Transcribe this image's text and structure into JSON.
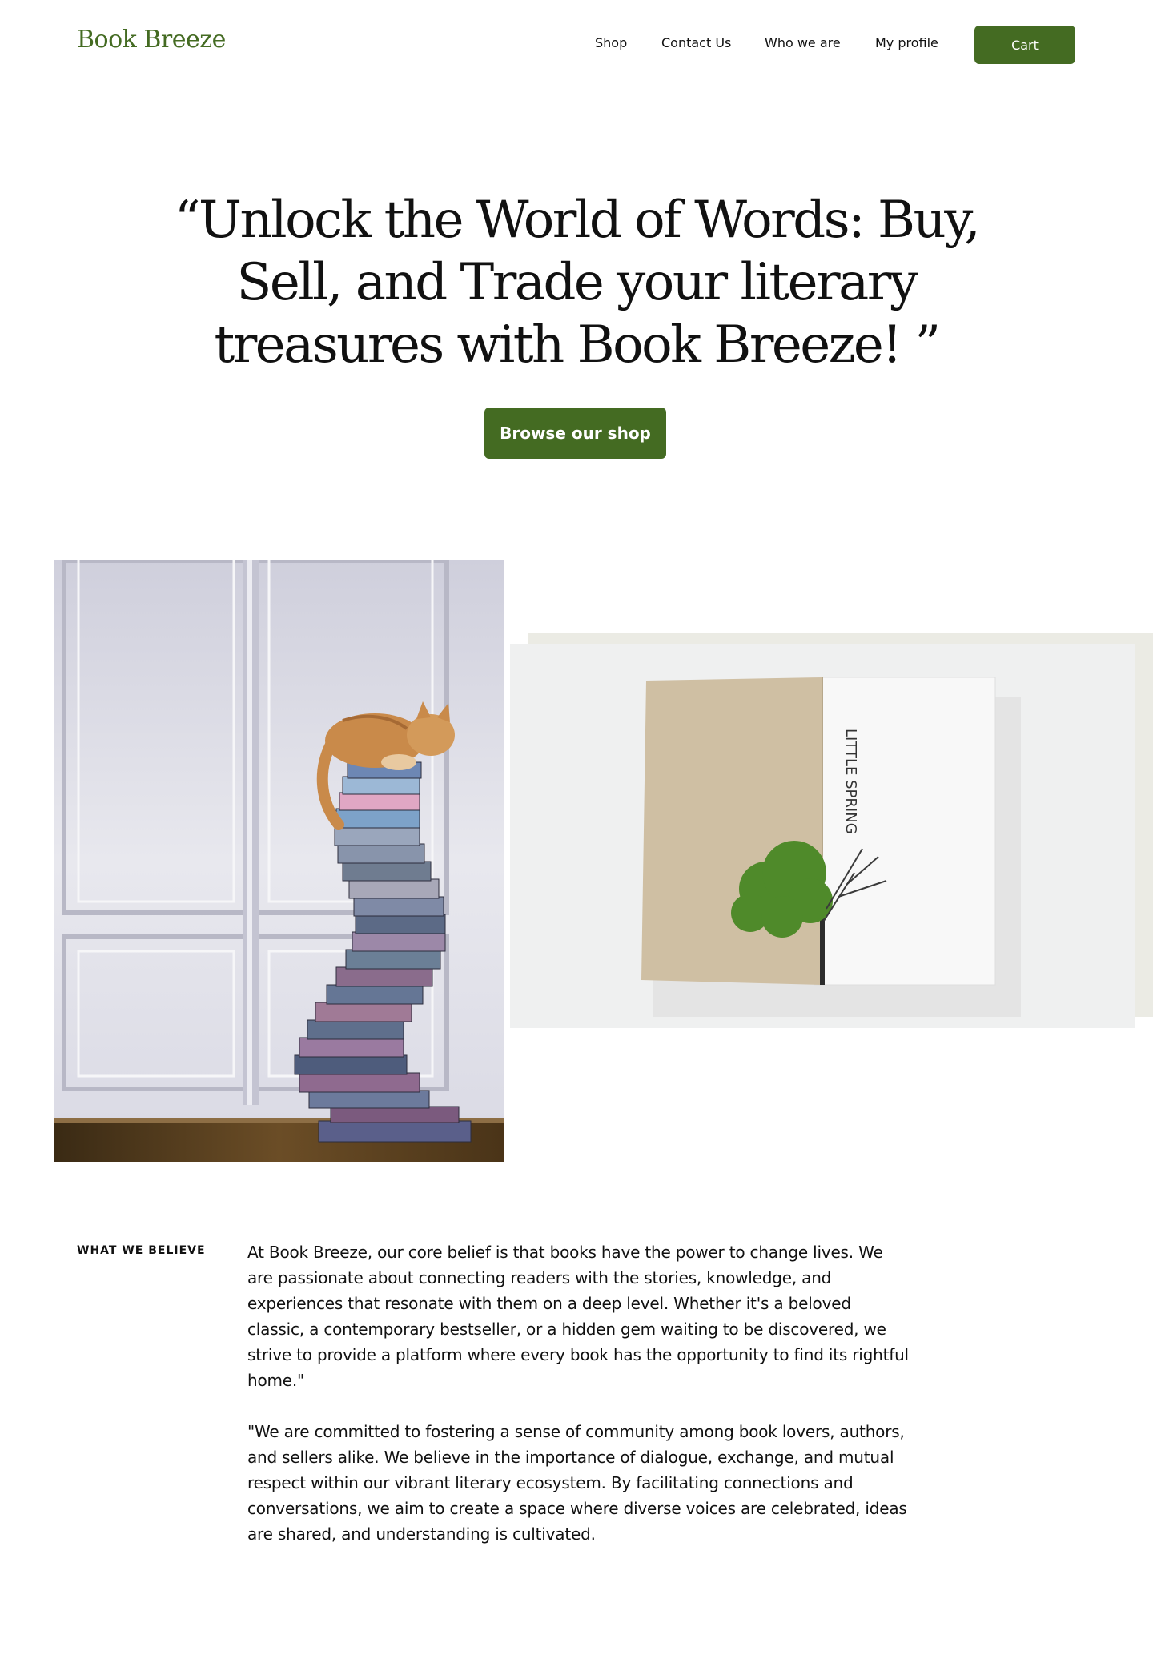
{
  "header": {
    "logo": "Book Breeze",
    "nav": [
      "Shop",
      "Contact Us",
      "Who we are",
      "My profile"
    ],
    "cart_label": "Cart"
  },
  "hero": {
    "title": "“Unlock the World of Words: Buy, Sell, and Trade your literary treasures with Book Breeze! ”",
    "cta_label": "Browse our shop"
  },
  "book_cover": {
    "text": "LITTLE SPRING"
  },
  "believe": {
    "label": "WHAT WE BELIEVE",
    "paragraphs": [
      "At Book Breeze, our core belief is that books have the power to change lives. We are passionate about connecting readers with the stories, knowledge, and experiences that resonate with them on a deep level. Whether it's a beloved classic, a contemporary bestseller, or a hidden gem waiting to be discovered, we strive to provide a platform where every book has the opportunity to find its rightful home.\"",
      "\"We are committed to fostering a sense of community among book lovers, authors, and sellers alike. We believe in the importance of dialogue, exchange, and mutual respect within our vibrant literary ecosystem. By facilitating connections and conversations, we aim to create a space where diverse voices are celebrated, ideas are shared, and understanding is cultivated."
    ]
  },
  "colors": {
    "brand_green": "#446b22"
  }
}
